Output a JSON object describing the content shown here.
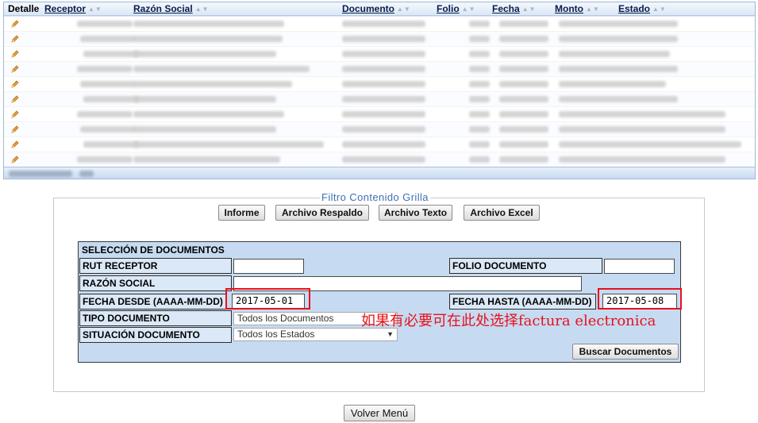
{
  "grid": {
    "columns": [
      {
        "label": "Detalle",
        "sortable": false
      },
      {
        "label": "Receptor",
        "sortable": true
      },
      {
        "label": "Razón Social",
        "sortable": true
      },
      {
        "label": "Documento",
        "sortable": true
      },
      {
        "label": "Folio",
        "sortable": true
      },
      {
        "label": "Fecha",
        "sortable": true
      },
      {
        "label": "Monto",
        "sortable": true
      },
      {
        "label": "Estado",
        "sortable": true
      }
    ],
    "sort_glyph": "▲▼",
    "row_icon": "edit-icon",
    "rows_visible": 10,
    "rows_note": "cell contents are blurred in the screenshot"
  },
  "filter": {
    "legend": "Filtro Contenido Grilla",
    "buttons": {
      "informe": "Informe",
      "respaldo": "Archivo Respaldo",
      "texto": "Archivo Texto",
      "excel": "Archivo Excel"
    },
    "form": {
      "title": "SELECCIÓN DE DOCUMENTOS",
      "rut_receptor": {
        "label": "RUT RECEPTOR",
        "value": ""
      },
      "folio_documento": {
        "label": "FOLIO DOCUMENTO",
        "value": ""
      },
      "razon_social": {
        "label": "RAZÓN SOCIAL",
        "value": ""
      },
      "fecha_desde": {
        "label": "FECHA DESDE (AAAA-MM-DD)",
        "value": "2017-05-01"
      },
      "fecha_hasta": {
        "label": "FECHA HASTA (AAAA-MM-DD)",
        "value": "2017-05-08"
      },
      "tipo_documento": {
        "label": "TIPO DOCUMENTO",
        "selected": "Todos los Documentos"
      },
      "situacion_documento": {
        "label": "SITUACIÓN DOCUMENTO",
        "selected": "Todos los Estados"
      },
      "buscar": "Buscar Documentos"
    }
  },
  "annotation": {
    "text": "如果有必要可在此处选择factura electronica",
    "color": "#e8101c"
  },
  "volver": "Volver Menú",
  "colors": {
    "grid_bg": "#d9e6f5",
    "form_bg": "#c6dbf1",
    "legend": "#3f6fb3",
    "highlight": "#e8101c"
  }
}
